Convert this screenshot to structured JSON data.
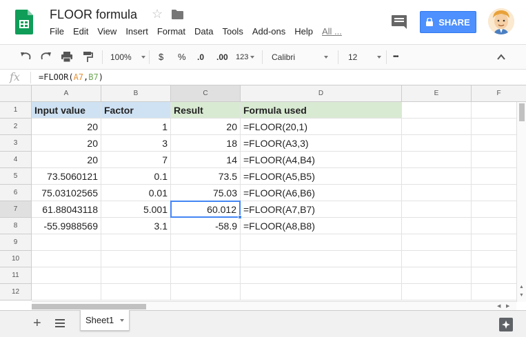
{
  "header": {
    "doc_title": "FLOOR formula",
    "menu": [
      "File",
      "Edit",
      "View",
      "Insert",
      "Format",
      "Data",
      "Tools",
      "Add-ons",
      "Help"
    ],
    "all_changes": "All ...",
    "share_label": "SHARE"
  },
  "toolbar": {
    "zoom": "100%",
    "currency": "$",
    "percent": "%",
    "dec_decrease": ".0",
    "dec_increase": ".00",
    "more_formats": "123",
    "font": "Calibri",
    "font_size": "12",
    "more": "•••"
  },
  "formula_bar": {
    "fx": "fx",
    "formula_prefix": "=FLOOR(",
    "ref1": "A7",
    "comma": ",",
    "ref2": "B7",
    "formula_suffix": ")"
  },
  "columns": [
    "A",
    "B",
    "C",
    "D",
    "E",
    "F"
  ],
  "rows": [
    "1",
    "2",
    "3",
    "4",
    "5",
    "6",
    "7",
    "8",
    "9",
    "10",
    "11",
    "12"
  ],
  "cells": {
    "header": [
      "Input value",
      "Factor",
      "Result",
      "Formula used"
    ],
    "data": [
      [
        "20",
        "1",
        "20",
        "=FLOOR(20,1)"
      ],
      [
        "20",
        "3",
        "18",
        "=FLOOR(A3,3)"
      ],
      [
        "20",
        "7",
        "14",
        "=FLOOR(A4,B4)"
      ],
      [
        "73.5060121",
        "0.1",
        "73.5",
        "=FLOOR(A5,B5)"
      ],
      [
        "75.03102565",
        "0.01",
        "75.03",
        "=FLOOR(A6,B6)"
      ],
      [
        "61.88043118",
        "5.001",
        "60.012",
        "=FLOOR(A7,B7)"
      ],
      [
        "-55.9988569",
        "3.1",
        "-58.9",
        "=FLOOR(A8,B8)"
      ]
    ]
  },
  "sheets": [
    "Sheet1"
  ],
  "colors": {
    "accent": "#4285f4",
    "share": "#4d90fe",
    "header_blue": "#cfe2f3",
    "header_green": "#d9ead3",
    "ref1_color": "#e69138",
    "ref2_color": "#6aa84f"
  }
}
